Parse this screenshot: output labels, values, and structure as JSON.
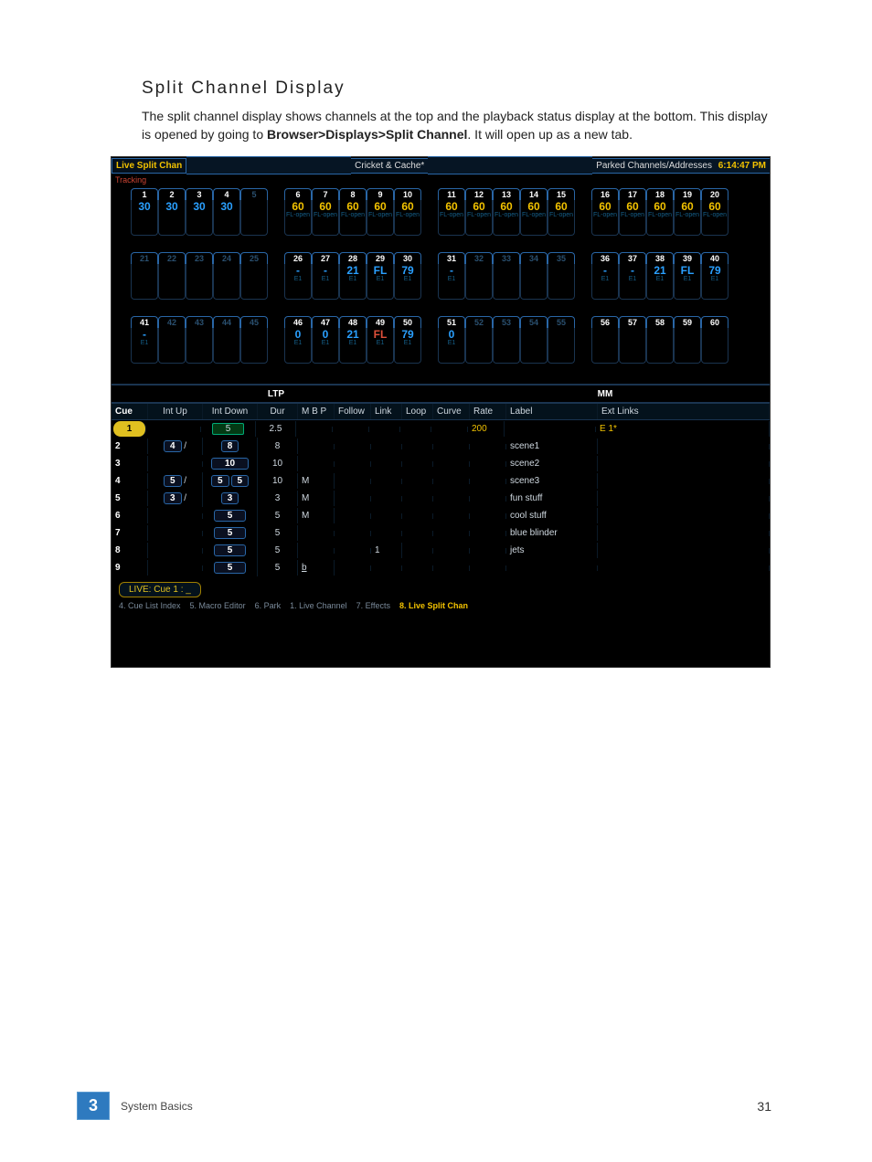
{
  "doc": {
    "heading": "Split Channel Display",
    "body_1a": "The split channel display shows channels at the top and the playback status display at the bottom. This display is opened by going to ",
    "body_1b": "Browser>Displays>Split Channel",
    "body_1c": ". It will open up as a new tab."
  },
  "topbar": {
    "left": "Live Split Chan",
    "mid": "Cricket & Cache*",
    "right": "Parked Channels/Addresses",
    "clock": "6:14:47 PM",
    "tracking": "Tracking"
  },
  "channels": {
    "rows": [
      [
        {
          "n": "1",
          "lvl": "30",
          "cls": "l-blue",
          "sub": "",
          "dim": false
        },
        {
          "n": "2",
          "lvl": "30",
          "cls": "l-blue",
          "sub": "",
          "dim": false
        },
        {
          "n": "3",
          "lvl": "30",
          "cls": "l-blue",
          "sub": "",
          "dim": false
        },
        {
          "n": "4",
          "lvl": "30",
          "cls": "l-blue",
          "sub": "",
          "dim": false
        },
        {
          "n": "5",
          "lvl": "",
          "cls": "",
          "sub": "",
          "dim": true
        },
        null,
        {
          "n": "6",
          "lvl": "60",
          "cls": "l-yellow",
          "sub": "FL-open",
          "dim": false
        },
        {
          "n": "7",
          "lvl": "60",
          "cls": "l-yellow",
          "sub": "FL-open",
          "dim": false
        },
        {
          "n": "8",
          "lvl": "60",
          "cls": "l-yellow",
          "sub": "FL-open",
          "dim": false
        },
        {
          "n": "9",
          "lvl": "60",
          "cls": "l-yellow",
          "sub": "FL-open",
          "dim": false
        },
        {
          "n": "10",
          "lvl": "60",
          "cls": "l-yellow",
          "sub": "FL-open",
          "dim": false
        },
        null,
        {
          "n": "11",
          "lvl": "60",
          "cls": "l-yellow",
          "sub": "FL-open",
          "dim": false
        },
        {
          "n": "12",
          "lvl": "60",
          "cls": "l-yellow",
          "sub": "FL-open",
          "dim": false
        },
        {
          "n": "13",
          "lvl": "60",
          "cls": "l-yellow",
          "sub": "FL-open",
          "dim": false
        },
        {
          "n": "14",
          "lvl": "60",
          "cls": "l-yellow",
          "sub": "FL-open",
          "dim": false
        },
        {
          "n": "15",
          "lvl": "60",
          "cls": "l-yellow",
          "sub": "FL-open",
          "dim": false
        },
        null,
        {
          "n": "16",
          "lvl": "60",
          "cls": "l-yellow",
          "sub": "FL-open",
          "dim": false
        },
        {
          "n": "17",
          "lvl": "60",
          "cls": "l-yellow",
          "sub": "FL-open",
          "dim": false
        },
        {
          "n": "18",
          "lvl": "60",
          "cls": "l-yellow",
          "sub": "FL-open",
          "dim": false
        },
        {
          "n": "19",
          "lvl": "60",
          "cls": "l-yellow",
          "sub": "FL-open",
          "dim": false
        },
        {
          "n": "20",
          "lvl": "60",
          "cls": "l-yellow",
          "sub": "FL-open",
          "dim": false
        }
      ],
      [
        {
          "n": "21",
          "lvl": "",
          "cls": "",
          "sub": "",
          "dim": true
        },
        {
          "n": "22",
          "lvl": "",
          "cls": "",
          "sub": "",
          "dim": true
        },
        {
          "n": "23",
          "lvl": "",
          "cls": "",
          "sub": "",
          "dim": true
        },
        {
          "n": "24",
          "lvl": "",
          "cls": "",
          "sub": "",
          "dim": true
        },
        {
          "n": "25",
          "lvl": "",
          "cls": "",
          "sub": "",
          "dim": true
        },
        null,
        {
          "n": "26",
          "lvl": "-",
          "cls": "l-blue",
          "sub": "E1",
          "dim": false
        },
        {
          "n": "27",
          "lvl": "-",
          "cls": "l-blue",
          "sub": "E1",
          "dim": false
        },
        {
          "n": "28",
          "lvl": "21",
          "cls": "l-blue",
          "sub": "E1",
          "dim": false
        },
        {
          "n": "29",
          "lvl": "FL",
          "cls": "l-blue",
          "sub": "E1",
          "dim": false
        },
        {
          "n": "30",
          "lvl": "79",
          "cls": "l-blue",
          "sub": "E1",
          "dim": false
        },
        null,
        {
          "n": "31",
          "lvl": "-",
          "cls": "l-blue",
          "sub": "E1",
          "dim": false
        },
        {
          "n": "32",
          "lvl": "",
          "cls": "",
          "sub": "",
          "dim": true
        },
        {
          "n": "33",
          "lvl": "",
          "cls": "",
          "sub": "",
          "dim": true
        },
        {
          "n": "34",
          "lvl": "",
          "cls": "",
          "sub": "",
          "dim": true
        },
        {
          "n": "35",
          "lvl": "",
          "cls": "",
          "sub": "",
          "dim": true
        },
        null,
        {
          "n": "36",
          "lvl": "-",
          "cls": "l-blue",
          "sub": "E1",
          "dim": false
        },
        {
          "n": "37",
          "lvl": "-",
          "cls": "l-blue",
          "sub": "E1",
          "dim": false
        },
        {
          "n": "38",
          "lvl": "21",
          "cls": "l-blue",
          "sub": "E1",
          "dim": false
        },
        {
          "n": "39",
          "lvl": "FL",
          "cls": "l-blue",
          "sub": "E1",
          "dim": false
        },
        {
          "n": "40",
          "lvl": "79",
          "cls": "l-blue",
          "sub": "E1",
          "dim": false
        }
      ],
      [
        {
          "n": "41",
          "lvl": "-",
          "cls": "l-blue",
          "sub": "E1",
          "dim": false
        },
        {
          "n": "42",
          "lvl": "",
          "cls": "",
          "sub": "",
          "dim": true
        },
        {
          "n": "43",
          "lvl": "",
          "cls": "",
          "sub": "",
          "dim": true
        },
        {
          "n": "44",
          "lvl": "",
          "cls": "",
          "sub": "",
          "dim": true
        },
        {
          "n": "45",
          "lvl": "",
          "cls": "",
          "sub": "",
          "dim": true
        },
        null,
        {
          "n": "46",
          "lvl": "0",
          "cls": "l-blue",
          "sub": "E1",
          "dim": false
        },
        {
          "n": "47",
          "lvl": "0",
          "cls": "l-blue",
          "sub": "E1",
          "dim": false
        },
        {
          "n": "48",
          "lvl": "21",
          "cls": "l-blue",
          "sub": "E1",
          "dim": false
        },
        {
          "n": "49",
          "lvl": "FL",
          "cls": "l-red",
          "sub": "E1",
          "dim": false
        },
        {
          "n": "50",
          "lvl": "79",
          "cls": "l-blue",
          "sub": "E1",
          "dim": false
        },
        null,
        {
          "n": "51",
          "lvl": "0",
          "cls": "l-blue",
          "sub": "E1",
          "dim": false
        },
        {
          "n": "52",
          "lvl": "",
          "cls": "",
          "sub": "",
          "dim": true
        },
        {
          "n": "53",
          "lvl": "",
          "cls": "",
          "sub": "",
          "dim": true
        },
        {
          "n": "54",
          "lvl": "",
          "cls": "",
          "sub": "",
          "dim": true
        },
        {
          "n": "55",
          "lvl": "",
          "cls": "",
          "sub": "",
          "dim": true
        },
        null,
        {
          "n": "56",
          "lvl": "",
          "cls": "",
          "sub": "",
          "dim": false
        },
        {
          "n": "57",
          "lvl": "",
          "cls": "",
          "sub": "",
          "dim": false
        },
        {
          "n": "58",
          "lvl": "",
          "cls": "",
          "sub": "",
          "dim": false
        },
        {
          "n": "59",
          "lvl": "",
          "cls": "",
          "sub": "",
          "dim": false
        },
        {
          "n": "60",
          "lvl": "",
          "cls": "",
          "sub": "",
          "dim": false
        }
      ]
    ]
  },
  "divider": {
    "ltp": "LTP",
    "mm": "MM"
  },
  "cue_table": {
    "headers": {
      "cue": "Cue",
      "intup": "Int Up",
      "intdown": "Int Down",
      "dur": "Dur",
      "mbp": "M B P",
      "follow": "Follow",
      "link": "Link",
      "loop": "Loop",
      "curve": "Curve",
      "rate": "Rate",
      "label": "Label",
      "ext": "Ext Links"
    },
    "rows": [
      {
        "cue": "1",
        "intup": "",
        "intdown": "5",
        "dur": "2.5",
        "mbp": "",
        "follow": "",
        "link": "",
        "loop": "",
        "curve": "",
        "rate": "200",
        "label": "",
        "ext": "E 1*",
        "current": true
      },
      {
        "cue": "2",
        "intup": "4",
        "intdown": "8",
        "dur": "8",
        "mbp": "",
        "follow": "",
        "link": "",
        "loop": "",
        "curve": "",
        "rate": "",
        "label": "scene1",
        "ext": "",
        "pilltype": "dbl"
      },
      {
        "cue": "3",
        "intup": "",
        "intdown": "10",
        "dur": "10",
        "mbp": "",
        "follow": "",
        "link": "",
        "loop": "",
        "curve": "",
        "rate": "",
        "label": "scene2",
        "ext": "",
        "pilltype": "single"
      },
      {
        "cue": "4",
        "intup": "5",
        "intdown": "5 5",
        "dur": "10",
        "mbp": "M",
        "follow": "",
        "link": "",
        "loop": "",
        "curve": "",
        "rate": "",
        "label": "scene3",
        "ext": "",
        "pilltype": "dbl-sub"
      },
      {
        "cue": "5",
        "intup": "3",
        "intdown": "3",
        "dur": "3",
        "mbp": "M",
        "follow": "",
        "link": "",
        "loop": "",
        "curve": "",
        "rate": "",
        "label": "fun stuff",
        "ext": "",
        "pilltype": "dbl"
      },
      {
        "cue": "6",
        "intup": "",
        "intdown": "5",
        "dur": "5",
        "mbp": "M",
        "follow": "",
        "link": "",
        "loop": "",
        "curve": "",
        "rate": "",
        "label": "cool stuff",
        "ext": "",
        "pilltype": "single"
      },
      {
        "cue": "7",
        "intup": "",
        "intdown": "5",
        "dur": "5",
        "mbp": "",
        "follow": "",
        "link": "",
        "loop": "",
        "curve": "",
        "rate": "",
        "label": "blue blinder",
        "ext": "",
        "pilltype": "single"
      },
      {
        "cue": "8",
        "intup": "",
        "intdown": "5",
        "dur": "5",
        "mbp": "",
        "follow": "",
        "link": "1",
        "loop": "",
        "curve": "",
        "rate": "",
        "label": "jets",
        "ext": "",
        "pilltype": "single"
      },
      {
        "cue": "9",
        "intup": "",
        "intdown": "5",
        "dur": "5",
        "mbp": "b",
        "follow": "",
        "link": "",
        "loop": "",
        "curve": "",
        "rate": "",
        "label": "",
        "ext": "",
        "pilltype": "single",
        "underline_mbp": true
      }
    ]
  },
  "cmd": {
    "text": "LIVE: Cue  1 :  _"
  },
  "tabs": [
    {
      "label": "4. Cue List Index",
      "active": false
    },
    {
      "label": "5. Macro Editor",
      "active": false
    },
    {
      "label": "6. Park",
      "active": false
    },
    {
      "label": "1. Live Channel",
      "active": false
    },
    {
      "label": "7. Effects",
      "active": false
    },
    {
      "label": "8. Live Split Chan",
      "active": true
    }
  ],
  "footer": {
    "chapter_num": "3",
    "chapter_label": "System Basics",
    "page": "31"
  }
}
